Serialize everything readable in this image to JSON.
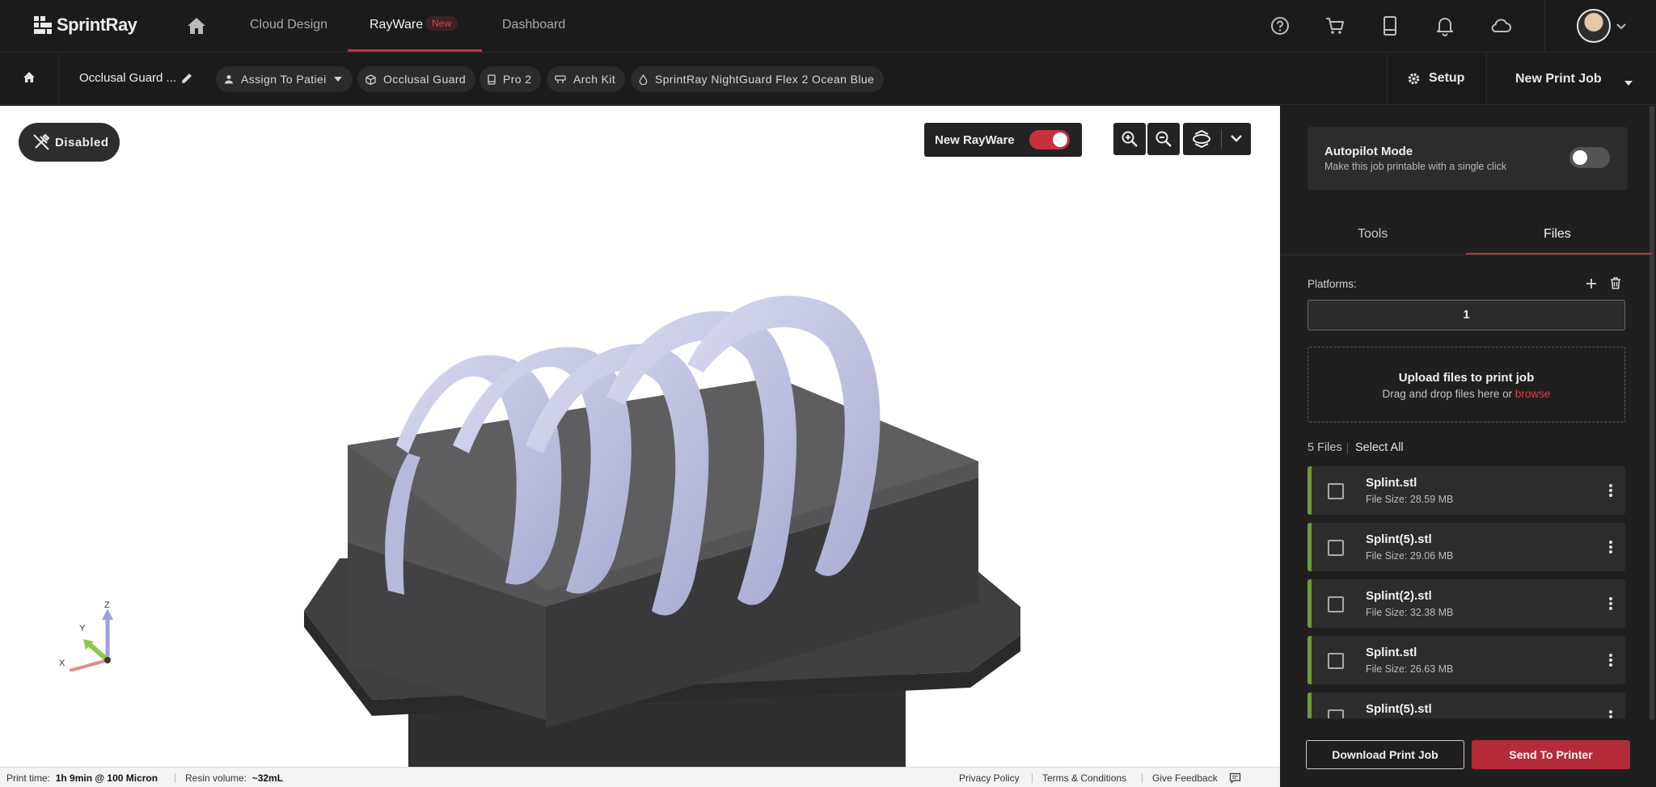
{
  "nav": {
    "logo": "SprintRay",
    "links": [
      "Cloud Design",
      "RayWare",
      "Dashboard"
    ],
    "new_badge": "New"
  },
  "jobbar": {
    "title": "Occlusal Guard ...",
    "chips": [
      "Assign To Patiei",
      "Occlusal Guard",
      "Pro 2",
      "Arch Kit",
      "SprintRay NightGuard Flex 2 Ocean Blue"
    ],
    "setup": "Setup",
    "new_print_job": "New Print Job"
  },
  "viewport": {
    "disabled_label": "Disabled",
    "rayware_toggle_label": "New RayWare",
    "rayware_toggle_on": true,
    "axes": {
      "x": "X",
      "y": "Y",
      "z": "Z"
    }
  },
  "statusbar": {
    "print_time_label": "Print time:",
    "print_time_value": "1h 9min @ 100 Micron",
    "resin_label": "Resin volume:",
    "resin_value": "~32mL",
    "links": [
      "Privacy Policy",
      "Terms & Conditions",
      "Give Feedback"
    ]
  },
  "panel": {
    "autopilot": {
      "title": "Autopilot Mode",
      "subtitle": "Make this job printable with a single click",
      "on": false
    },
    "tabs": [
      "Tools",
      "Files"
    ],
    "active_tab": "Files",
    "platforms_label": "Platforms:",
    "platforms_value": "1",
    "upload": {
      "title": "Upload files to print job",
      "sub": "Drag and drop files here or",
      "browse": "browse"
    },
    "files_count": "5 Files",
    "select_all": "Select All",
    "files": [
      {
        "name": "Splint.stl",
        "size": "File Size: 28.59 MB"
      },
      {
        "name": "Splint(5).stl",
        "size": "File Size: 29.06 MB"
      },
      {
        "name": "Splint(2).stl",
        "size": "File Size: 32.38 MB"
      },
      {
        "name": "Splint.stl",
        "size": "File Size: 26.63 MB"
      },
      {
        "name": "Splint(5).stl",
        "size": ""
      }
    ],
    "download_btn": "Download Print Job",
    "send_btn": "Send To Printer"
  },
  "colors": {
    "accent": "#c8303f",
    "file_ok": "#6e9a3b",
    "model": "#c3c6e6",
    "base": "#3b3b3d"
  }
}
